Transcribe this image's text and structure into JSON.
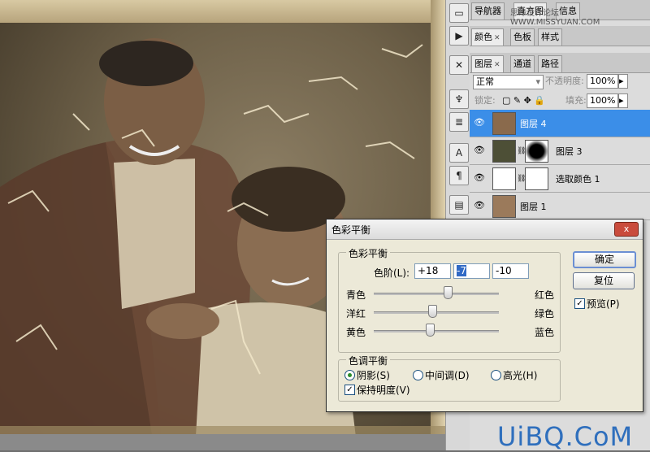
{
  "panels": {
    "navigator_tabs": [
      "导航器",
      "直方图",
      "信息"
    ],
    "color_tabs": [
      "颜色",
      "色板",
      "样式"
    ],
    "layer_tabs": [
      "图层",
      "通道",
      "路径"
    ],
    "blend_mode": "正常",
    "opacity_label": "不透明度:",
    "opacity_value": "100%",
    "lock_label": "锁定:",
    "fill_label": "填充:",
    "fill_value": "100%",
    "layers": [
      {
        "name": "图层 4",
        "selected": true
      },
      {
        "name": "图层 3",
        "selected": false
      },
      {
        "name": "选取颜色 1",
        "selected": false
      },
      {
        "name": "图层 1",
        "selected": false
      }
    ],
    "watermark_small": "思缘设计论坛 WWW.MISSYUAN.COM"
  },
  "dialog": {
    "title": "色彩平衡",
    "close": "x",
    "color_balance_legend": "色彩平衡",
    "levels_label": "色阶(L):",
    "levels": [
      "+18",
      "-7",
      "-10"
    ],
    "sliders": [
      {
        "left": "青色",
        "right": "红色",
        "value": 18
      },
      {
        "left": "洋红",
        "right": "绿色",
        "value": -7
      },
      {
        "left": "黄色",
        "right": "蓝色",
        "value": -10
      }
    ],
    "tone_legend": "色调平衡",
    "tones": [
      "阴影(S)",
      "中间调(D)",
      "高光(H)"
    ],
    "tone_selected": 0,
    "preserve_luminosity": "保持明度(V)",
    "ok": "确定",
    "reset": "复位",
    "preview": "预览(P)"
  },
  "watermark": "UiBQ.CoM",
  "colors": {
    "selection": "#3b8ee8",
    "watermark": "#2f6fbd"
  }
}
